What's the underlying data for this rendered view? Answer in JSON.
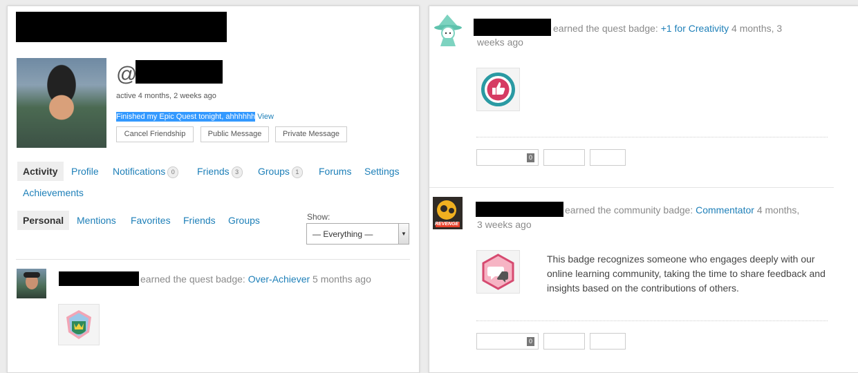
{
  "profile": {
    "at_sign": "@",
    "active": "active 4 months, 2 weeks ago",
    "status": "Finished my Epic Quest tonight, ahhhhhh",
    "status_view": "View",
    "buttons": {
      "cancel_friendship": "Cancel Friendship",
      "public_message": "Public Message",
      "private_message": "Private Message"
    }
  },
  "nav": {
    "activity": "Activity",
    "profile": "Profile",
    "notifications": "Notifications",
    "notifications_count": "0",
    "friends": "Friends",
    "friends_count": "3",
    "groups": "Groups",
    "groups_count": "1",
    "forums": "Forums",
    "settings": "Settings",
    "achievements": "Achievements"
  },
  "subnav": {
    "personal": "Personal",
    "mentions": "Mentions",
    "favorites": "Favorites",
    "friends": "Friends",
    "groups": "Groups",
    "show_label": "Show:",
    "show_value": "— Everything —"
  },
  "feed": {
    "left_item": {
      "text": "earned the quest badge:",
      "badge": "Over-Achiever",
      "time": "5 months ago"
    },
    "right_item_1": {
      "text": "earned the quest badge:",
      "badge": "+1 for Creativity",
      "time_a": "4 months, 3",
      "time_b": "weeks ago",
      "count": "0"
    },
    "right_item_2": {
      "text": "earned the community badge:",
      "badge": "Commentator",
      "time_a": "4 months,",
      "time_b": "3 weeks ago",
      "description": "This badge recognizes someone who engages deeply with our online learning community, taking the time to share feedback and insights based on the contributions of others.",
      "count": "0",
      "avatar_text": "REVENGE"
    }
  },
  "colors": {
    "link": "#1d7fb8",
    "highlight": "#3399ff"
  }
}
